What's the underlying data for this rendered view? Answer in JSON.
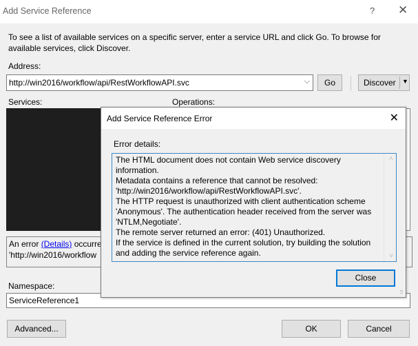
{
  "window": {
    "title": "Add Service Reference",
    "help_label": "?",
    "close_label": "✕"
  },
  "intro_text": "To see a list of available services on a specific server, enter a service URL and click Go. To browse for available services, click Discover.",
  "address": {
    "label": "Address:",
    "value": "http://win2016/workflow/api/RestWorkflowAPI.svc",
    "dropdown_icon": "⌵",
    "go_label": "Go",
    "discover_label": "Discover",
    "discover_arrow": "▼"
  },
  "services_label": "Services:",
  "operations_label": "Operations:",
  "error_bar": {
    "prefix": "An error ",
    "link": "(Details)",
    "suffix": " occurred",
    "line2": "'http://win2016/workflow"
  },
  "namespace": {
    "label": "Namespace:",
    "value": "ServiceReference1"
  },
  "buttons": {
    "advanced": "Advanced...",
    "ok": "OK",
    "cancel": "Cancel"
  },
  "error_dialog": {
    "title": "Add Service Reference Error",
    "close_icon": "✕",
    "details_label": "Error details:",
    "details_text": "The HTML document does not contain Web service discovery information.\nMetadata contains a reference that cannot be resolved: 'http://win2016/workflow/api/RestWorkflowAPI.svc'.\nThe HTTP request is unauthorized with client authentication scheme 'Anonymous'. The authentication header received from the server was 'NTLM,Negotiate'.\nThe remote server returned an error: (401) Unauthorized.\nIf the service is defined in the current solution, try building the solution and adding the service reference again.",
    "scroll_up": "˄",
    "scroll_down": "˅",
    "close_label": "Close",
    "grip": "⠿"
  }
}
